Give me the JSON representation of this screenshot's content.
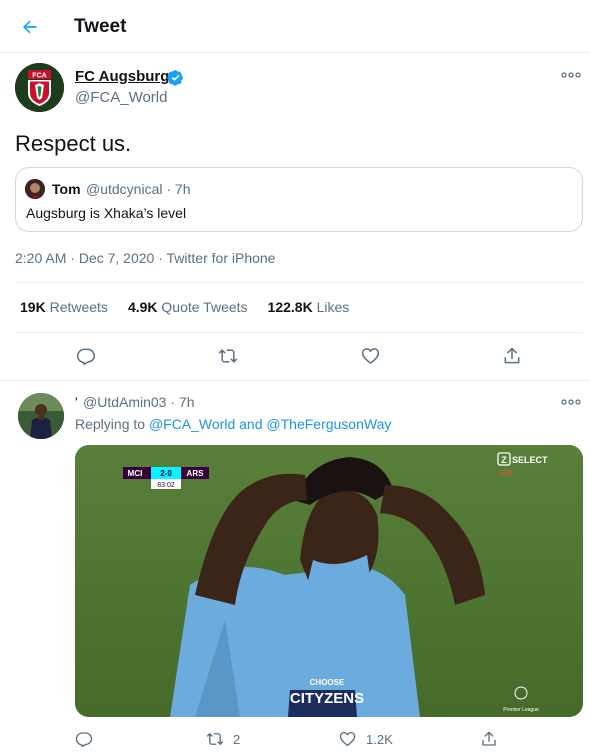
{
  "header": {
    "title": "Tweet"
  },
  "main_tweet": {
    "author_name": "FC Augsburg",
    "author_handle": "@FCA_World",
    "avatar_logo_text": "FCA",
    "text": "Respect us.",
    "quote": {
      "author_name": "Tom",
      "author_handle": "@utdcynical · 7h",
      "text": "Augsburg is Xhaka’s level"
    },
    "time": "2:20 AM",
    "date": "Dec 7, 2020",
    "client": "Twitter for iPhone",
    "stats": {
      "retweets": "19K",
      "retweets_label": "Retweets",
      "quotes": "4.9K",
      "quotes_label": "Quote Tweets",
      "likes": "122.8K",
      "likes_label": "Likes"
    }
  },
  "reply_tweet": {
    "author_name": "'",
    "author_handle": "@UtdAmin03 · 7h",
    "replying_prefix": "Replying to",
    "replying_to_1": "@FCA_World",
    "replying_and": "and",
    "replying_to_2": "@TheFergusonWay",
    "media": {
      "score_home": "MCI",
      "score": "2-0",
      "score_away": "ARS",
      "clock": "83:02",
      "channel": "SELECT",
      "channel_badge": "LIVE",
      "shirt_sponsor_top": "CHOOSE",
      "shirt_sponsor": "CITYZENS",
      "league_label": "Premier League"
    },
    "retweet_count": "2",
    "like_count": "1.2K"
  },
  "colors": {
    "accent": "#1da1f2",
    "link": "#1b95e0",
    "muted": "#5b7083",
    "pitch": "#4b6a2c",
    "kit": "#6cabdd"
  }
}
